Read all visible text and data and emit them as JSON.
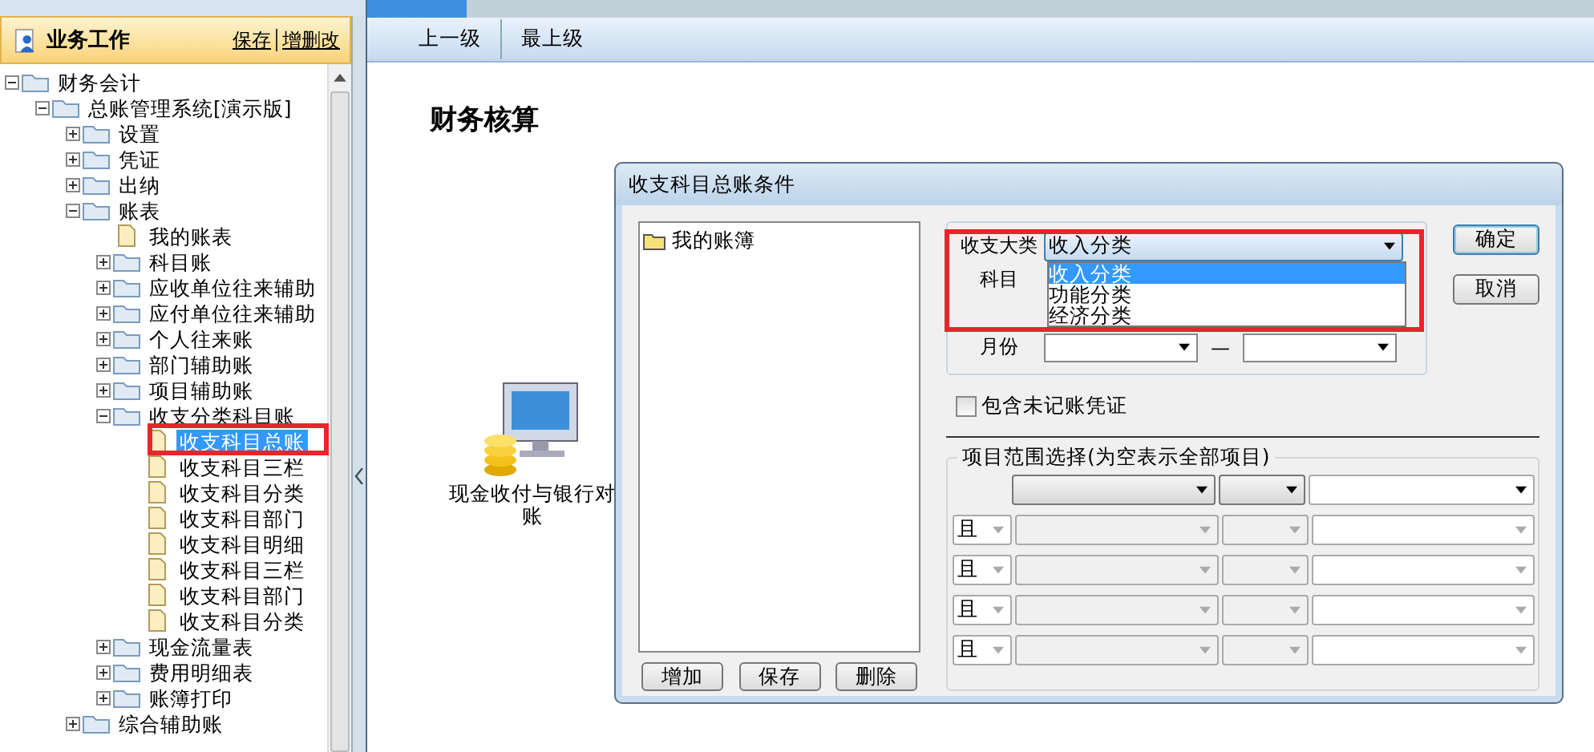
{
  "sidebar": {
    "title": "业务工作",
    "links": [
      "保存",
      "增删改"
    ],
    "tree": [
      {
        "label": "财务会计",
        "kind": "folder",
        "expanded": true,
        "selected": false,
        "children": [
          {
            "label": "总账管理系统[演示版]",
            "kind": "folder",
            "expanded": true,
            "selected": false,
            "children": [
              {
                "label": "设置",
                "kind": "folder",
                "expanded": false,
                "selected": false
              },
              {
                "label": "凭证",
                "kind": "folder",
                "expanded": false,
                "selected": false
              },
              {
                "label": "出纳",
                "kind": "folder",
                "expanded": false,
                "selected": false
              },
              {
                "label": "账表",
                "kind": "folder",
                "expanded": true,
                "selected": false,
                "children": [
                  {
                    "label": "我的账表",
                    "kind": "file",
                    "selected": false
                  },
                  {
                    "label": "科目账",
                    "kind": "folder",
                    "expanded": false,
                    "selected": false
                  },
                  {
                    "label": "应收单位往来辅助",
                    "kind": "folder",
                    "expanded": false,
                    "selected": false
                  },
                  {
                    "label": "应付单位往来辅助",
                    "kind": "folder",
                    "expanded": false,
                    "selected": false
                  },
                  {
                    "label": "个人往来账",
                    "kind": "folder",
                    "expanded": false,
                    "selected": false
                  },
                  {
                    "label": "部门辅助账",
                    "kind": "folder",
                    "expanded": false,
                    "selected": false
                  },
                  {
                    "label": "项目辅助账",
                    "kind": "folder",
                    "expanded": false,
                    "selected": false
                  },
                  {
                    "label": "收支分类科目账",
                    "kind": "folder",
                    "expanded": true,
                    "selected": false,
                    "children": [
                      {
                        "label": "收支科目总账",
                        "kind": "file",
                        "selected": true
                      },
                      {
                        "label": "收支科目三栏",
                        "kind": "file",
                        "selected": false
                      },
                      {
                        "label": "收支科目分类",
                        "kind": "file",
                        "selected": false
                      },
                      {
                        "label": "收支科目部门",
                        "kind": "file",
                        "selected": false
                      },
                      {
                        "label": "收支科目明细",
                        "kind": "file",
                        "selected": false
                      },
                      {
                        "label": "收支科目三栏",
                        "kind": "file",
                        "selected": false
                      },
                      {
                        "label": "收支科目部门",
                        "kind": "file",
                        "selected": false
                      },
                      {
                        "label": "收支科目分类",
                        "kind": "file",
                        "selected": false
                      }
                    ]
                  },
                  {
                    "label": "现金流量表",
                    "kind": "folder",
                    "expanded": false,
                    "selected": false
                  },
                  {
                    "label": "费用明细表",
                    "kind": "folder",
                    "expanded": false,
                    "selected": false
                  },
                  {
                    "label": "账簿打印",
                    "kind": "folder",
                    "expanded": false,
                    "selected": false
                  }
                ]
              },
              {
                "label": "综合辅助账",
                "kind": "folder",
                "expanded": false,
                "selected": false
              }
            ]
          }
        ]
      }
    ]
  },
  "toolbar": [
    "上一级",
    "最上级"
  ],
  "heading": "财务核算",
  "shortcut": {
    "label": "现金收付与银行对账"
  },
  "dialog": {
    "title": "收支科目总账条件",
    "books": [
      "我的账簿"
    ],
    "book_buttons": [
      "增加",
      "保存",
      "删除"
    ],
    "category": {
      "label": "收支大类",
      "value": "收入分类",
      "open": true,
      "options": [
        {
          "label": "收入分类",
          "selected": true
        },
        {
          "label": "功能分类",
          "selected": false
        },
        {
          "label": "经济分类",
          "selected": false
        }
      ]
    },
    "subject": {
      "label": "科目"
    },
    "month": {
      "label": "月份",
      "separator": "—"
    },
    "buttons": [
      "确定",
      "取消"
    ],
    "checkbox": {
      "label": "包含未记账凭证",
      "checked": false
    },
    "range": {
      "title": "项目范围选择(为空表示全部项目)",
      "conditions": [
        "且",
        "且",
        "且",
        "且"
      ]
    }
  }
}
